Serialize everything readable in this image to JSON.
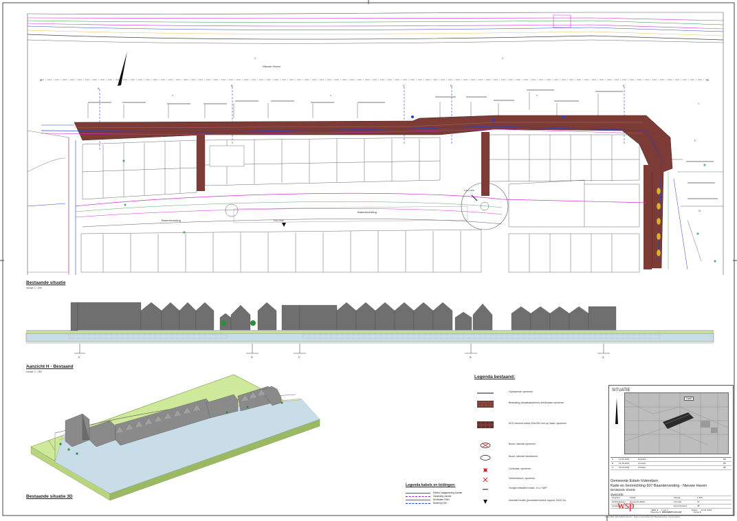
{
  "situation_plan": {
    "water_label": "Nieuwe Haven",
    "street_label_1": "Baandervesting",
    "street_label_2": "Baandervesting",
    "wave_symbol": "≈",
    "section_marks": [
      "H",
      "H",
      "A",
      "B",
      "C",
      "D",
      "E",
      "F",
      "G"
    ],
    "point_label": "Kraan 0158",
    "point_label_2": "Kraan 0158",
    "lg_dim": "1.450"
  },
  "headings": {
    "bestaande": "Bestaande situatie",
    "bestaande_scale": "schaal: 1 : 250",
    "aanzicht": "Aanzicht H - Bestaand",
    "aanzicht_scale": "schaal: 1 : 250",
    "situatie_3d": "Bestaande situatie 3D"
  },
  "elevation_marks": [
    "E",
    "D",
    "C",
    "B",
    "A"
  ],
  "legend_bestaand": {
    "title": "Legenda bestaand:",
    "items": [
      {
        "symbol": "line-black",
        "text": "Oplossende opnemen"
      },
      {
        "symbol": "brick-hatch",
        "text": "Bestrating (straatbakstenen) deklichaam opnemen"
      },
      {
        "symbol": "brick-dark",
        "text": "KES element metra 200x200 mm op 'kaan' opnemen"
      },
      {
        "symbol": "bollard-red",
        "text": "Boom, latende opnemen"
      },
      {
        "symbol": "bollard-white",
        "text": "Boom, latende handhaven"
      },
      {
        "symbol": "lamp-red",
        "text": "Lichtmast, opnemen"
      },
      {
        "symbol": "x-red",
        "text": "Verkeersbord, opnemen"
      },
      {
        "symbol": "dash",
        "text": "Hoogte bestaand maaiv. t.o.v. NAP"
      },
      {
        "symbol": "triangle",
        "text": "Indicatie locatie grondwatermeters rapport 10431 hs"
      }
    ]
  },
  "legend_kabels": {
    "title": "Legenda kabels en leidingen:",
    "items": [
      {
        "color": "#d2232a",
        "text": "Elektra Laagspanning Liander"
      },
      {
        "color": "#7b2fbf",
        "text": "Gasleiding Liander"
      },
      {
        "color": "#2a8f3a",
        "text": "Drinkwater PWN"
      },
      {
        "color": "#2440d0",
        "text": "Riolering HVK"
      }
    ]
  },
  "title_block": {
    "situatie": "SITUATIE",
    "keymap_label": "Kaart",
    "revisions": [
      [
        "A",
        "11-01-2023",
        "Definitief",
        "RK"
      ],
      [
        "B",
        "15-10-2022",
        "Concept",
        "RK"
      ],
      [
        "C",
        "15-03-2022",
        "Ontwerp",
        "RK"
      ]
    ],
    "client": "Gemeente Edam-Volendam",
    "project": "Kade en herinrichting 607 Baandervesting - Nieuwe Haven",
    "drawing": "Bestaande situatie",
    "subtitle": "Overzicht",
    "fields": [
      [
        "Projectnr.",
        "10431",
        "Schaal",
        "1:250"
      ],
      [
        "Opdrachtgever",
        "Gemeente Edam",
        "Formaat",
        "A1"
      ],
      [
        "Getekend",
        "RK",
        "Gecontroleerd",
        "JB"
      ],
      [
        "Blad nr.",
        "1 van 3",
        "Datum",
        "11-01-2023"
      ],
      [
        "Tekening nr.",
        "WIS.D28271.101.107",
        "Versie",
        "D"
      ]
    ],
    "logo": "wsp"
  },
  "colors": {
    "brick": "#7d3b36",
    "building": "#6f6f6f",
    "grass": "#cfe99a",
    "water": "#c9dde8",
    "accent_magenta": "#d02fd0",
    "accent_blue": "#2440d0"
  },
  "footer": "Huidig Blad: WIS.D28271.101.107 - Kade en herinrichting 607 Baandervesting - Nieuwe Haven"
}
